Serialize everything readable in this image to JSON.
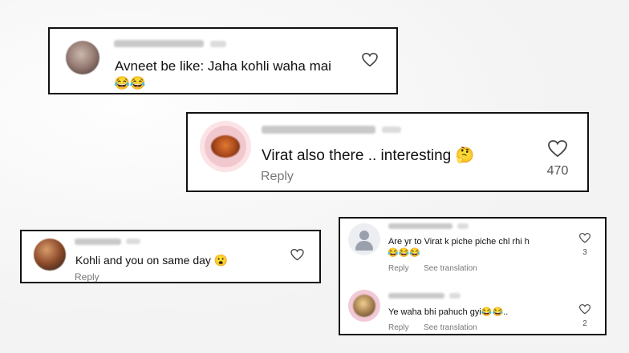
{
  "comments": [
    {
      "text": "Avneet be like: Jaha kohli waha mai",
      "emojis": "😂😂"
    },
    {
      "text": "Virat also there .. interesting 🤔",
      "reply": "Reply",
      "likes": "470"
    },
    {
      "text": "Kohli and you on same day 😮",
      "reply": "Reply"
    },
    {
      "text": "Are yr to Virat k piche piche chl rhi h",
      "emojis": "😂😂😂",
      "reply": "Reply",
      "see_translation": "See translation",
      "likes": "3"
    },
    {
      "text": "Ye waha bhi pahuch gyi😂😂..",
      "reply": "Reply",
      "see_translation": "See translation",
      "likes": "2"
    }
  ],
  "colors": {
    "border": "#111111",
    "muted": "#777777",
    "emoji": "#f7c531"
  },
  "icons": [
    "heart-icon",
    "blurred-avatar"
  ]
}
